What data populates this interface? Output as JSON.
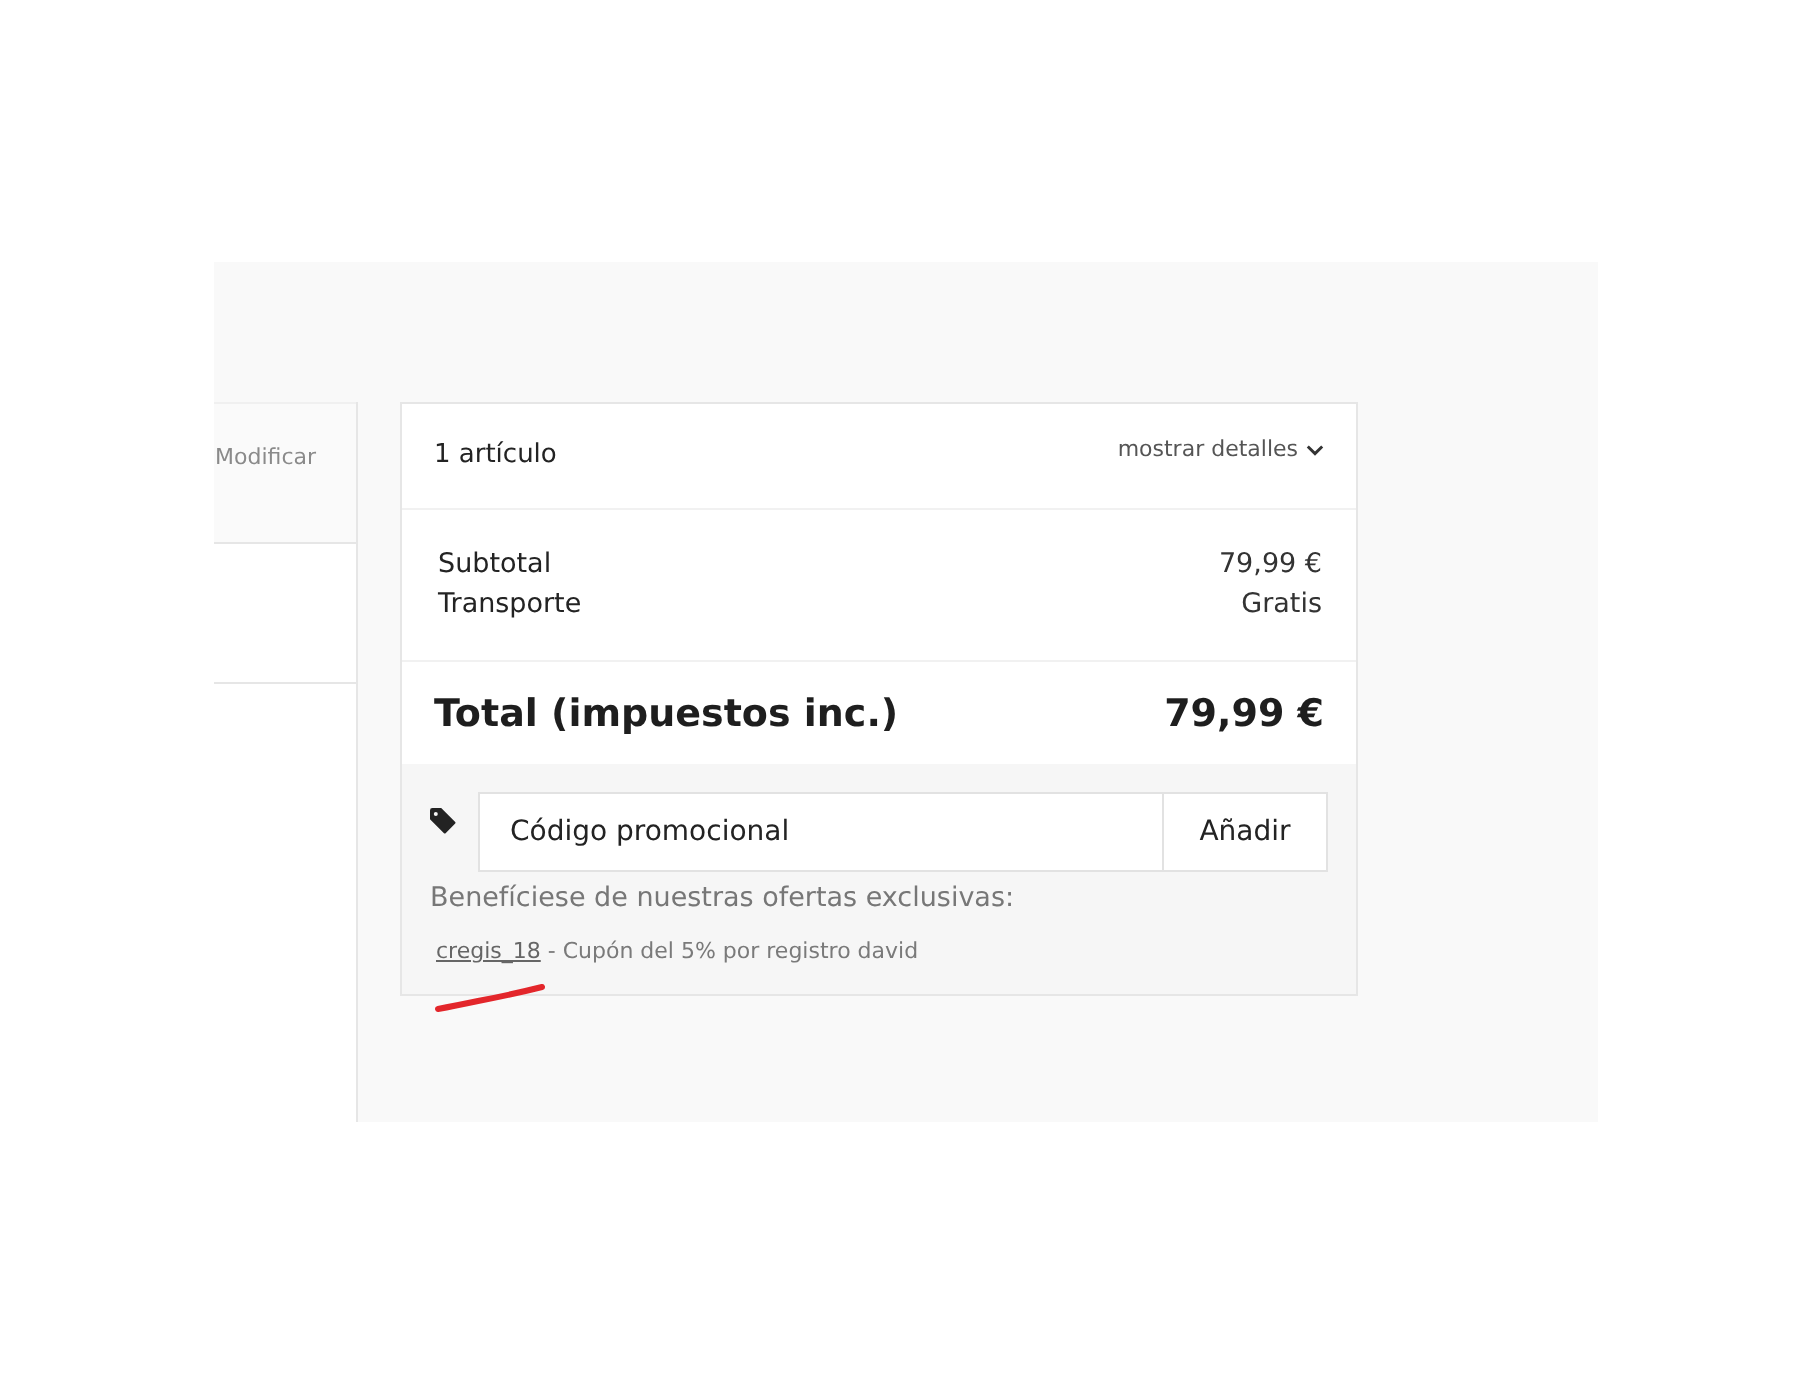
{
  "side_panel": {
    "link": "Modificar"
  },
  "cart_summary": {
    "item_count": "1 artículo",
    "details_toggle": {
      "label": "mostrar detalles",
      "expanded": false
    },
    "lines": [
      {
        "label": "Subtotal",
        "value": "79,99 €"
      },
      {
        "label": "Transporte",
        "value": "Gratis"
      }
    ],
    "total": {
      "label": "Total (impuestos inc.)",
      "value": "79,99 €"
    }
  },
  "promo": {
    "placeholder": "Código promocional",
    "button": "Añadir",
    "intro": "Benefíciese de nuestras ofertas exclusivas:",
    "offers": [
      {
        "code": "cregis_18",
        "description": "- Cupón del 5% por registro david"
      }
    ]
  },
  "annotation": {
    "kind": "underline"
  }
}
